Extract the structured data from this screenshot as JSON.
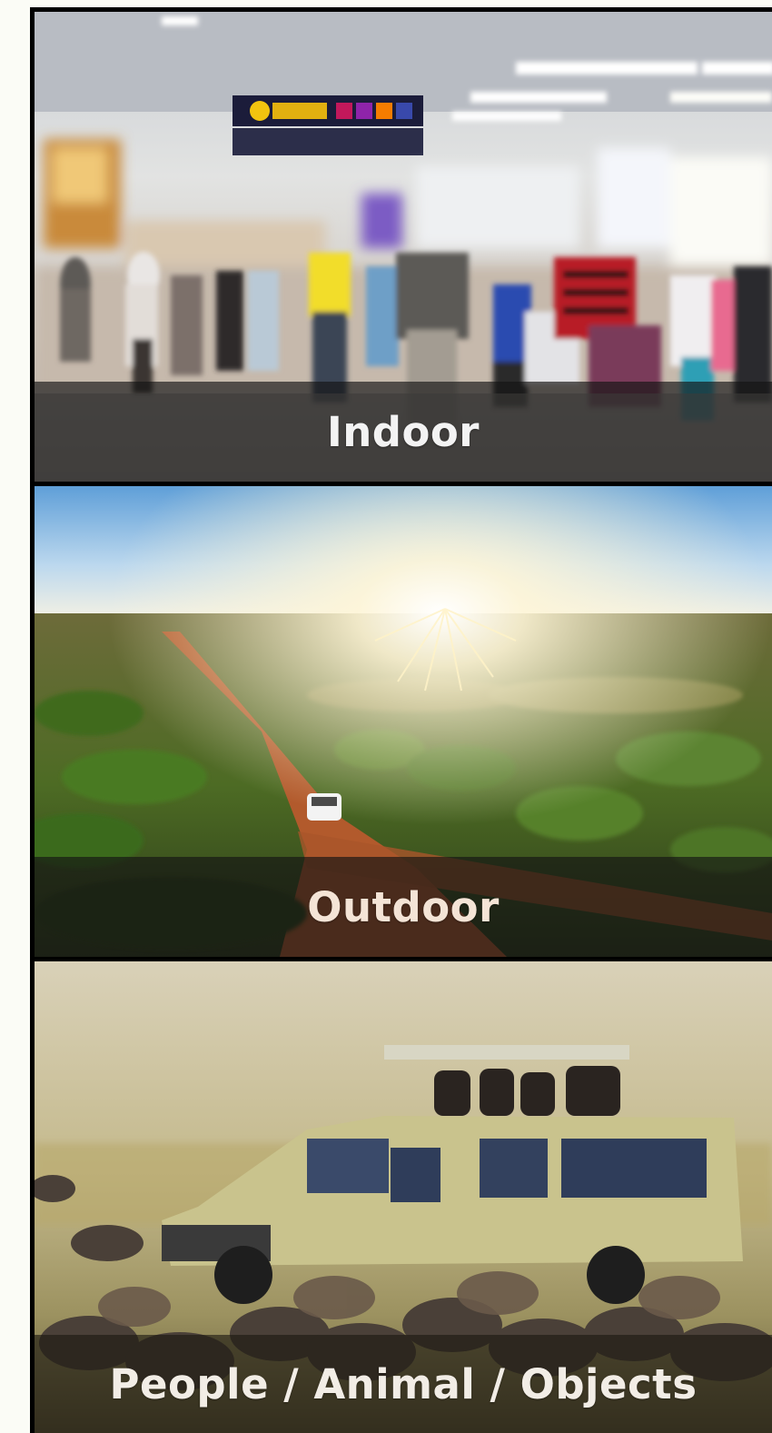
{
  "gallery": {
    "categories": [
      {
        "label": "Indoor",
        "image_icon": "airport-terminal-crowd-image"
      },
      {
        "label": "Outdoor",
        "image_icon": "desert-road-sunrise-image"
      },
      {
        "label": "People / Animal / Objects",
        "image_icon": "safari-jeep-wildebeest-image"
      }
    ]
  },
  "colors": {
    "page_background": "#fbfcf6",
    "frame": "#000000",
    "caption_overlay": "#141414",
    "caption_text": "#f3f3f3"
  }
}
